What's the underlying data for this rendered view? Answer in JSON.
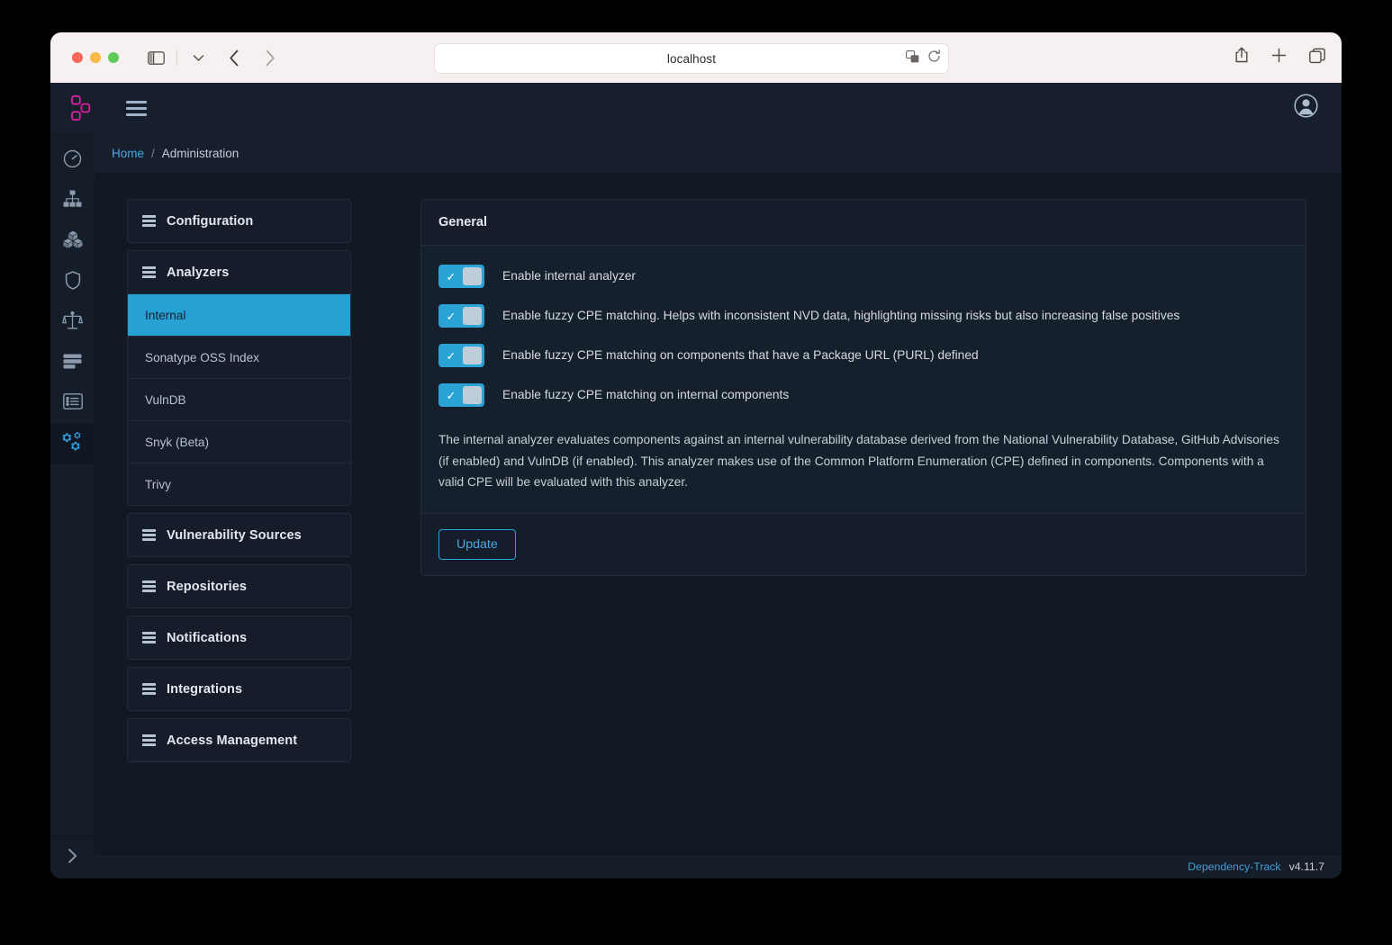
{
  "browser": {
    "url": "localhost",
    "icons": {
      "sidebar": "sidebar-toggle-icon",
      "dropdown": "chevron-down-icon",
      "back": "back-chevron-icon",
      "forward": "forward-chevron-icon",
      "reader": "translate-icon",
      "reload": "reload-icon",
      "share": "share-icon",
      "newtab": "plus-icon",
      "tabs": "tab-overview-icon"
    }
  },
  "app": {
    "logo": "dependency-track-logo",
    "menu_icon": "hamburger-menu-icon",
    "avatar_icon": "user-avatar-icon",
    "accent": "#2aa3d6",
    "brand_pink": "#d6219b"
  },
  "rail": {
    "items": [
      {
        "name": "dashboard",
        "icon": "gauge-icon",
        "active": false
      },
      {
        "name": "projects",
        "icon": "hierarchy-icon",
        "active": false
      },
      {
        "name": "components",
        "icon": "cubes-icon",
        "active": false
      },
      {
        "name": "vulnerabilities",
        "icon": "shield-icon",
        "active": false
      },
      {
        "name": "licenses",
        "icon": "scales-icon",
        "active": false
      },
      {
        "name": "policy-management",
        "icon": "server-stack-icon",
        "active": false
      },
      {
        "name": "audit",
        "icon": "list-panel-icon",
        "active": false
      },
      {
        "name": "administration",
        "icon": "gears-icon",
        "active": true
      }
    ],
    "expand_icon": "chevron-right-icon"
  },
  "breadcrumb": {
    "home": "Home",
    "separator": "/",
    "current": "Administration"
  },
  "adminnav": {
    "groups": [
      {
        "label": "Configuration",
        "items": []
      },
      {
        "label": "Analyzers",
        "items": [
          {
            "label": "Internal",
            "active": true
          },
          {
            "label": "Sonatype OSS Index",
            "active": false
          },
          {
            "label": "VulnDB",
            "active": false
          },
          {
            "label": "Snyk (Beta)",
            "active": false
          },
          {
            "label": "Trivy",
            "active": false
          }
        ]
      },
      {
        "label": "Vulnerability Sources",
        "items": []
      },
      {
        "label": "Repositories",
        "items": []
      },
      {
        "label": "Notifications",
        "items": []
      },
      {
        "label": "Integrations",
        "items": []
      },
      {
        "label": "Access Management",
        "items": []
      }
    ]
  },
  "panel": {
    "title": "General",
    "switches": [
      {
        "label": "Enable internal analyzer",
        "checked": true
      },
      {
        "label": "Enable fuzzy CPE matching. Helps with inconsistent NVD data, highlighting missing risks but also increasing false positives",
        "checked": true
      },
      {
        "label": "Enable fuzzy CPE matching on components that have a Package URL (PURL) defined",
        "checked": true
      },
      {
        "label": "Enable fuzzy CPE matching on internal components",
        "checked": true
      }
    ],
    "help_text": "The internal analyzer evaluates components against an internal vulnerability database derived from the National Vulnerability Database, GitHub Advisories (if enabled) and VulnDB (if enabled). This analyzer makes use of the Common Platform Enumeration (CPE) defined in components. Components with a valid CPE will be evaluated with this analyzer.",
    "update_label": "Update",
    "check_glyph": "✓"
  },
  "footer": {
    "brand": "Dependency-Track",
    "version": "v4.11.7"
  }
}
